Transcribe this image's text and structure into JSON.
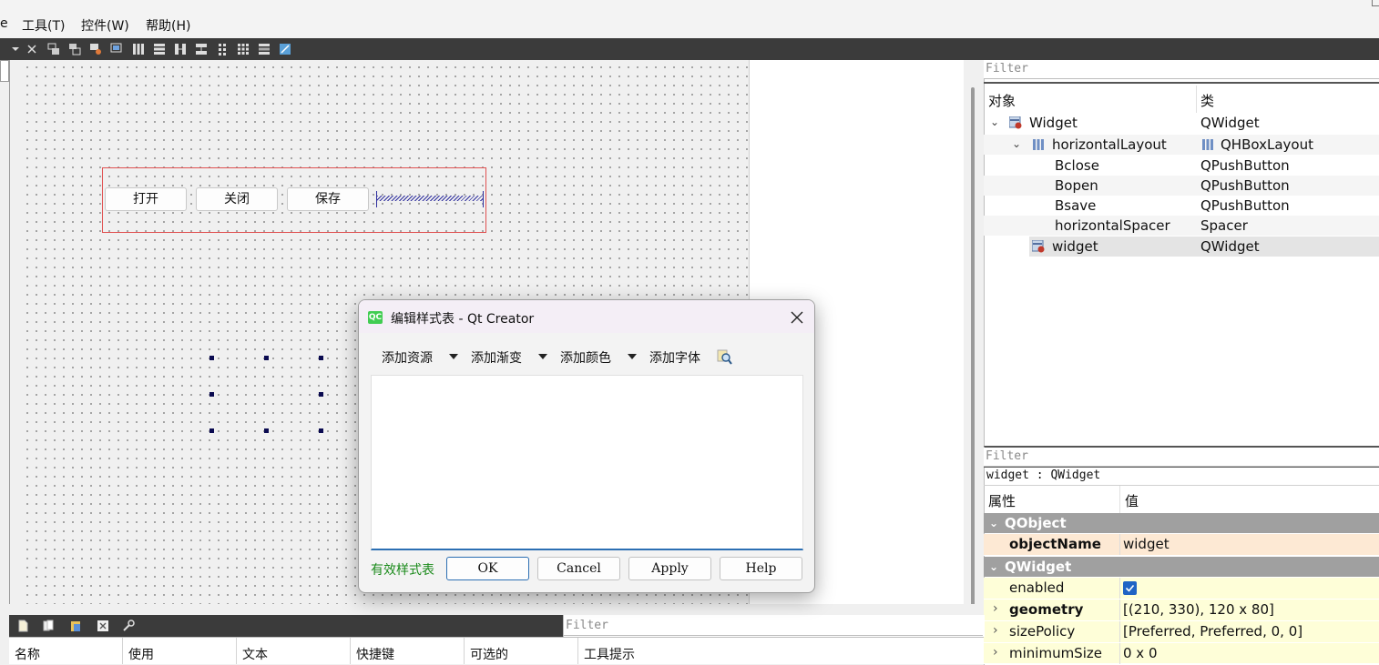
{
  "menubar": {
    "items": [
      "e",
      "工具(T)",
      "控件(W)",
      "帮助(H)"
    ]
  },
  "form": {
    "buttons": [
      "打开",
      "关闭",
      "保存"
    ]
  },
  "object_inspector": {
    "filter_placeholder": "Filter",
    "columns": [
      "对象",
      "类"
    ],
    "rows": [
      {
        "name": "Widget",
        "class": "QWidget",
        "icon": "widget-icon",
        "expanded": true
      },
      {
        "name": "horizontalLayout",
        "class": "QHBoxLayout",
        "icon": "hbox-layout-icon",
        "expanded": true
      },
      {
        "name": "Bclose",
        "class": "QPushButton"
      },
      {
        "name": "Bopen",
        "class": "QPushButton"
      },
      {
        "name": "Bsave",
        "class": "QPushButton"
      },
      {
        "name": "horizontalSpacer",
        "class": "Spacer"
      },
      {
        "name": "widget",
        "class": "QWidget",
        "icon": "widget-icon",
        "selected": true
      }
    ]
  },
  "property_editor": {
    "filter_placeholder": "Filter",
    "context": "widget : QWidget",
    "columns": [
      "属性",
      "值"
    ],
    "groups": [
      {
        "title": "QObject",
        "rows": [
          {
            "key": "objectName",
            "value": "widget"
          }
        ]
      },
      {
        "title": "QWidget",
        "rows": [
          {
            "key": "enabled",
            "value": "",
            "checked": true
          },
          {
            "key": "geometry",
            "value": "[(210, 330), 120 x 80]"
          },
          {
            "key": "sizePolicy",
            "value": "[Preferred, Preferred, 0, 0]"
          },
          {
            "key": "minimumSize",
            "value": "0 x 0"
          }
        ]
      }
    ]
  },
  "action_editor": {
    "filter_placeholder": "Filter",
    "columns": [
      "名称",
      "使用",
      "文本",
      "快捷键",
      "可选的",
      "工具提示"
    ]
  },
  "dialog": {
    "title": "编辑样式表 - Qt Creator",
    "logo_text": "QC",
    "tools": [
      "添加资源",
      "添加渐变",
      "添加颜色",
      "添加字体"
    ],
    "status": "有效样式表",
    "buttons": {
      "ok": "OK",
      "cancel": "Cancel",
      "apply": "Apply",
      "help": "Help"
    }
  },
  "colors": {
    "toolbar_bg": "#3b3b3b",
    "layout_border": "#e05252",
    "selection_handle": "#0a0a50",
    "property_group": "#a0a0a0",
    "property_row": "#fefed8",
    "valid_text": "#1a8a1a",
    "focus_blue": "#2c6fb3"
  }
}
